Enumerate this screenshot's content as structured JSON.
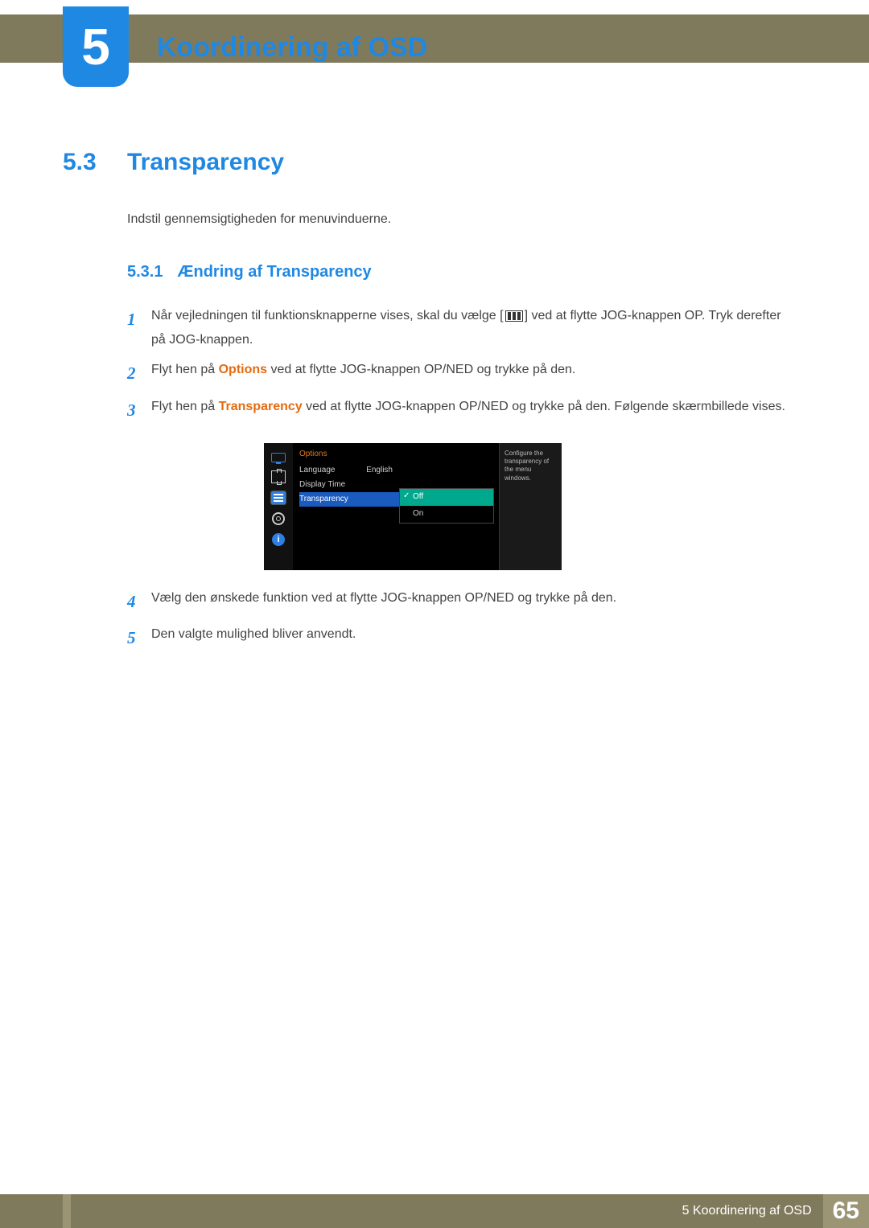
{
  "chapter": {
    "number": "5",
    "title": "Koordinering af OSD"
  },
  "section": {
    "number": "5.3",
    "title": "Transparency"
  },
  "intro": "Indstil gennemsigtigheden for menuvinduerne.",
  "subsection": {
    "number": "5.3.1",
    "title": "Ændring af Transparency"
  },
  "steps": {
    "s1": {
      "num": "1",
      "pre": "Når vejledningen til funktionsknapperne vises, skal du vælge [",
      "post": "] ved at flytte JOG-knappen OP. Tryk derefter på JOG-knappen."
    },
    "s2": {
      "num": "2",
      "pre": "Flyt hen på ",
      "hl": "Options",
      "post": " ved at flytte JOG-knappen OP/NED og trykke på den."
    },
    "s3": {
      "num": "3",
      "pre": "Flyt hen på ",
      "hl": "Transparency",
      "post": " ved at flytte JOG-knappen OP/NED og trykke på den. Følgende skærmbillede vises."
    },
    "s4": {
      "num": "4",
      "text": "Vælg den ønskede funktion ved at flytte JOG-knappen OP/NED og trykke på den."
    },
    "s5": {
      "num": "5",
      "text": "Den valgte mulighed bliver anvendt."
    }
  },
  "osd": {
    "title": "Options",
    "rows": {
      "language": {
        "label": "Language",
        "value": "English"
      },
      "displaytime": {
        "label": "Display Time",
        "value": ""
      },
      "transparency": {
        "label": "Transparency",
        "value": ""
      }
    },
    "opts": {
      "off": "Off",
      "on": "On"
    },
    "desc": "Configure the transparency of the menu windows.",
    "info_glyph": "i"
  },
  "footer": {
    "text": "5 Koordinering af OSD",
    "page": "65"
  }
}
